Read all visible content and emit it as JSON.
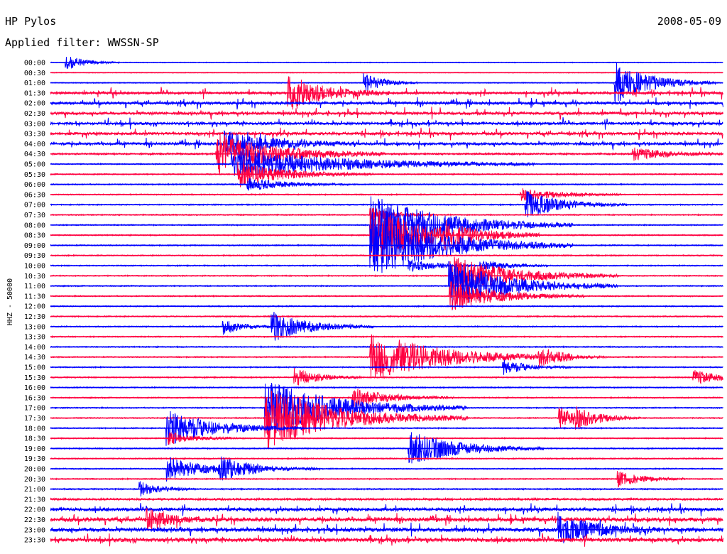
{
  "header": {
    "station": "HP Pylos",
    "filter": "Applied filter: WWSSN-SP",
    "date": "2008-05-09"
  },
  "chart_data": {
    "type": "line",
    "title": "HP Pylos",
    "subtitle": "Applied filter: WWSSN-SP",
    "date": "2008-05-09",
    "ylabel": "HHZ - 50000",
    "xlabel": "",
    "y_tick_labels": [
      "00:00",
      "00:30",
      "01:00",
      "01:30",
      "02:00",
      "02:30",
      "03:00",
      "03:30",
      "04:00",
      "04:30",
      "05:00",
      "05:30",
      "06:00",
      "06:30",
      "07:00",
      "07:30",
      "08:00",
      "08:30",
      "09:00",
      "09:30",
      "10:00",
      "10:30",
      "11:00",
      "11:30",
      "12:00",
      "12:30",
      "13:00",
      "13:30",
      "14:00",
      "14:30",
      "15:00",
      "15:30",
      "16:00",
      "16:30",
      "17:00",
      "17:30",
      "18:00",
      "18:30",
      "19:00",
      "19:30",
      "20:00",
      "20:30",
      "21:00",
      "21:30",
      "22:00",
      "22:30",
      "23:00",
      "23:30"
    ],
    "x_range_minutes": [
      0,
      30
    ],
    "colors": {
      "series_a": "#0000ff",
      "series_b": "#ff0040"
    },
    "noise_by_trace": [
      0.5,
      0.5,
      0.6,
      1.6,
      1.8,
      1.8,
      1.8,
      1.8,
      1.8,
      1.2,
      0.8,
      0.8,
      0.8,
      0.8,
      0.8,
      0.8,
      0.8,
      0.8,
      0.8,
      0.8,
      0.8,
      0.8,
      0.8,
      0.8,
      0.8,
      0.8,
      0.8,
      0.8,
      0.8,
      0.8,
      0.8,
      0.8,
      0.8,
      0.8,
      0.8,
      0.8,
      0.8,
      0.8,
      0.8,
      0.8,
      0.8,
      0.8,
      0.9,
      1.4,
      2.2,
      2.6,
      2.6,
      2.6
    ],
    "events": [
      {
        "trace": 0,
        "t_min": 0.7,
        "amp": 1.5,
        "dur_min": 0.8
      },
      {
        "trace": 2,
        "t_min": 14.0,
        "amp": 2.0,
        "dur_min": 0.8
      },
      {
        "trace": 2,
        "t_min": 25.2,
        "amp": 4.0,
        "dur_min": 1.5
      },
      {
        "trace": 3,
        "t_min": 10.6,
        "amp": 3.5,
        "dur_min": 1.5
      },
      {
        "trace": 8,
        "t_min": 7.8,
        "amp": 2.5,
        "dur_min": 2.0
      },
      {
        "trace": 9,
        "t_min": 7.4,
        "amp": 4.0,
        "dur_min": 2.5
      },
      {
        "trace": 9,
        "t_min": 26.0,
        "amp": 1.2,
        "dur_min": 1.5
      },
      {
        "trace": 10,
        "t_min": 8.1,
        "amp": 3.2,
        "dur_min": 4.5
      },
      {
        "trace": 11,
        "t_min": 8.4,
        "amp": 2.5,
        "dur_min": 2.0
      },
      {
        "trace": 12,
        "t_min": 8.8,
        "amp": 1.3,
        "dur_min": 1.5
      },
      {
        "trace": 13,
        "t_min": 21.0,
        "amp": 1.3,
        "dur_min": 1.5
      },
      {
        "trace": 14,
        "t_min": 21.2,
        "amp": 2.8,
        "dur_min": 1.5
      },
      {
        "trace": 15,
        "t_min": 14.3,
        "amp": 1.5,
        "dur_min": 1.0
      },
      {
        "trace": 16,
        "t_min": 14.3,
        "amp": 6.0,
        "dur_min": 3.0
      },
      {
        "trace": 17,
        "t_min": 14.3,
        "amp": 5.5,
        "dur_min": 2.5
      },
      {
        "trace": 17,
        "t_min": 17.6,
        "amp": 1.5,
        "dur_min": 1.0
      },
      {
        "trace": 18,
        "t_min": 14.3,
        "amp": 6.5,
        "dur_min": 3.0
      },
      {
        "trace": 20,
        "t_min": 16.0,
        "amp": 1.3,
        "dur_min": 1.0
      },
      {
        "trace": 20,
        "t_min": 19.2,
        "amp": 1.2,
        "dur_min": 1.0
      },
      {
        "trace": 21,
        "t_min": 17.8,
        "amp": 4.0,
        "dur_min": 2.5
      },
      {
        "trace": 22,
        "t_min": 17.8,
        "amp": 5.0,
        "dur_min": 2.5
      },
      {
        "trace": 23,
        "t_min": 17.8,
        "amp": 3.0,
        "dur_min": 2.0
      },
      {
        "trace": 26,
        "t_min": 9.9,
        "amp": 3.0,
        "dur_min": 1.5
      },
      {
        "trace": 26,
        "t_min": 7.7,
        "amp": 1.5,
        "dur_min": 0.8
      },
      {
        "trace": 29,
        "t_min": 14.3,
        "amp": 5.0,
        "dur_min": 3.0
      },
      {
        "trace": 29,
        "t_min": 21.8,
        "amp": 1.5,
        "dur_min": 1.0
      },
      {
        "trace": 30,
        "t_min": 20.2,
        "amp": 1.5,
        "dur_min": 1.0
      },
      {
        "trace": 31,
        "t_min": 10.9,
        "amp": 1.8,
        "dur_min": 1.0
      },
      {
        "trace": 31,
        "t_min": 28.7,
        "amp": 1.5,
        "dur_min": 1.0
      },
      {
        "trace": 33,
        "t_min": 13.5,
        "amp": 2.0,
        "dur_min": 1.5
      },
      {
        "trace": 34,
        "t_min": 9.6,
        "amp": 5.5,
        "dur_min": 3.0
      },
      {
        "trace": 35,
        "t_min": 9.6,
        "amp": 6.0,
        "dur_min": 3.0
      },
      {
        "trace": 35,
        "t_min": 22.7,
        "amp": 2.2,
        "dur_min": 1.0
      },
      {
        "trace": 35,
        "t_min": 23.4,
        "amp": 1.5,
        "dur_min": 1.0
      },
      {
        "trace": 36,
        "t_min": 5.2,
        "amp": 3.5,
        "dur_min": 2.0
      },
      {
        "trace": 37,
        "t_min": 5.3,
        "amp": 1.2,
        "dur_min": 1.0
      },
      {
        "trace": 38,
        "t_min": 16.0,
        "amp": 3.5,
        "dur_min": 2.0
      },
      {
        "trace": 40,
        "t_min": 5.2,
        "amp": 2.5,
        "dur_min": 1.5
      },
      {
        "trace": 40,
        "t_min": 7.5,
        "amp": 2.0,
        "dur_min": 1.5
      },
      {
        "trace": 41,
        "t_min": 25.3,
        "amp": 1.5,
        "dur_min": 1.0
      },
      {
        "trace": 42,
        "t_min": 4.0,
        "amp": 1.5,
        "dur_min": 0.8
      },
      {
        "trace": 45,
        "t_min": 4.3,
        "amp": 2.0,
        "dur_min": 1.0
      },
      {
        "trace": 46,
        "t_min": 22.7,
        "amp": 3.0,
        "dur_min": 1.5
      }
    ]
  }
}
